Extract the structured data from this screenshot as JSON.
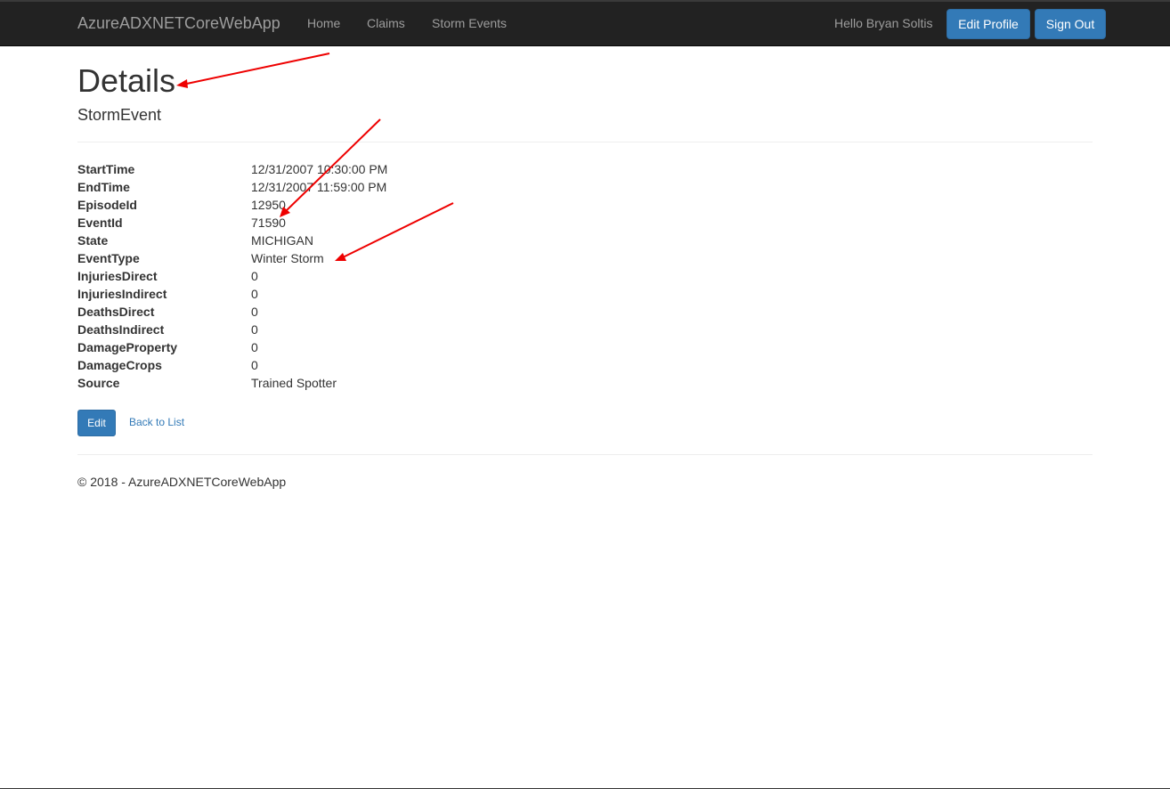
{
  "navbar": {
    "brand": "AzureADXNETCoreWebApp",
    "links": [
      "Home",
      "Claims",
      "Storm Events"
    ],
    "greeting": "Hello Bryan Soltis",
    "edit_profile": "Edit Profile",
    "sign_out": "Sign Out"
  },
  "page": {
    "title": "Details",
    "subtitle": "StormEvent"
  },
  "details": [
    {
      "label": "StartTime",
      "value": "12/31/2007 10:30:00 PM"
    },
    {
      "label": "EndTime",
      "value": "12/31/2007 11:59:00 PM"
    },
    {
      "label": "EpisodeId",
      "value": "12950"
    },
    {
      "label": "EventId",
      "value": "71590"
    },
    {
      "label": "State",
      "value": "MICHIGAN"
    },
    {
      "label": "EventType",
      "value": "Winter Storm"
    },
    {
      "label": "InjuriesDirect",
      "value": "0"
    },
    {
      "label": "InjuriesIndirect",
      "value": "0"
    },
    {
      "label": "DeathsDirect",
      "value": "0"
    },
    {
      "label": "DeathsIndirect",
      "value": "0"
    },
    {
      "label": "DamageProperty",
      "value": "0"
    },
    {
      "label": "DamageCrops",
      "value": "0"
    },
    {
      "label": "Source",
      "value": "Trained Spotter"
    }
  ],
  "actions": {
    "edit": "Edit",
    "back": "Back to List"
  },
  "footer": {
    "text": "© 2018 - AzureADXNETCoreWebApp"
  },
  "colors": {
    "primary": "#337ab7",
    "navbar": "#222222",
    "annotation": "#ff0000"
  }
}
